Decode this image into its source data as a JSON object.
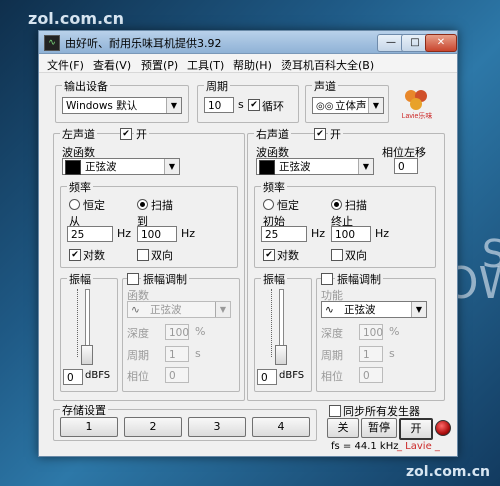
{
  "desktop": {
    "watermark_top": "zol.com.cn",
    "watermark_bottom": "zol.com.cn",
    "bg_letter_s": "S",
    "bg_letter_ow": "OW"
  },
  "window": {
    "title": "由好听、耐用乐味耳机提供3.92",
    "min_label": "—",
    "max_label": "□",
    "close_label": "✕"
  },
  "menu": [
    "文件(F)",
    "查看(V)",
    "预置(P)",
    "工具(T)",
    "帮助(H)",
    "烫耳机百科大全(B)"
  ],
  "output": {
    "label": "输出设备",
    "value": "Windows 默认"
  },
  "period": {
    "label": "周期",
    "value": "10",
    "unit": "s",
    "loop_label": "循环",
    "loop_checked": true
  },
  "channel": {
    "label": "声道",
    "value": "立体声"
  },
  "logo_text": "Lavie乐味",
  "left": {
    "title": "左声道",
    "on_label": "开",
    "waveform_label": "波函数",
    "waveform_value": "正弦波",
    "freq_label": "频率",
    "const_label": "恒定",
    "sweep_label": "扫描",
    "from_label": "从",
    "to_label": "到",
    "from_value": "25",
    "to_value": "100",
    "hz1": "Hz",
    "hz2": "Hz",
    "log_label": "对数",
    "bidir_label": "双向",
    "amp_label": "振幅",
    "amp_value": "0",
    "amp_unit": "dBFS",
    "ammod_label": "振幅调制",
    "func_label": "函数",
    "mod_wave_value": "正弦波",
    "depth_label": "深度",
    "depth_value": "100",
    "depth_unit": "%",
    "period_label": "周期",
    "period_value": "1",
    "period_unit": "s",
    "phase_label": "相位",
    "phase_value": "0"
  },
  "right": {
    "title": "右声道",
    "on_label": "开",
    "waveform_label": "波函数",
    "waveform_value": "正弦波",
    "phase_shift_label": "相位左移",
    "phase_shift_value": "0",
    "freq_label": "频率",
    "const_label": "恒定",
    "sweep_label": "扫描",
    "from_label": "初始",
    "to_label": "终止",
    "from_value": "25",
    "to_value": "100",
    "hz1": "Hz",
    "hz2": "Hz",
    "log_label": "对数",
    "bidir_label": "双向",
    "amp_label": "振幅",
    "amp_value": "0",
    "amp_unit": "dBFS",
    "ammod_label": "振幅调制",
    "func_label": "功能",
    "mod_wave_value": "正弦波",
    "depth_label": "深度",
    "depth_value": "100",
    "depth_unit": "%",
    "period_label": "周期",
    "period_value": "1",
    "period_unit": "s",
    "phase_label": "相位",
    "phase_value": "0"
  },
  "presets": {
    "label": "存储设置",
    "buttons": [
      "1",
      "2",
      "3",
      "4"
    ]
  },
  "controls": {
    "sync_label": "同步所有发生器",
    "off_label": "关",
    "pause_label": "暂停",
    "on_label": "开",
    "fs_text": "fs = 44.1 kHz",
    "brand_text": "_ Lavie _"
  },
  "check_mark": "✔",
  "combo_arrow": "▼",
  "colors": {
    "accent": "#c8452e",
    "brand_red": "#cc2a2a",
    "indicator": "#b01010"
  }
}
